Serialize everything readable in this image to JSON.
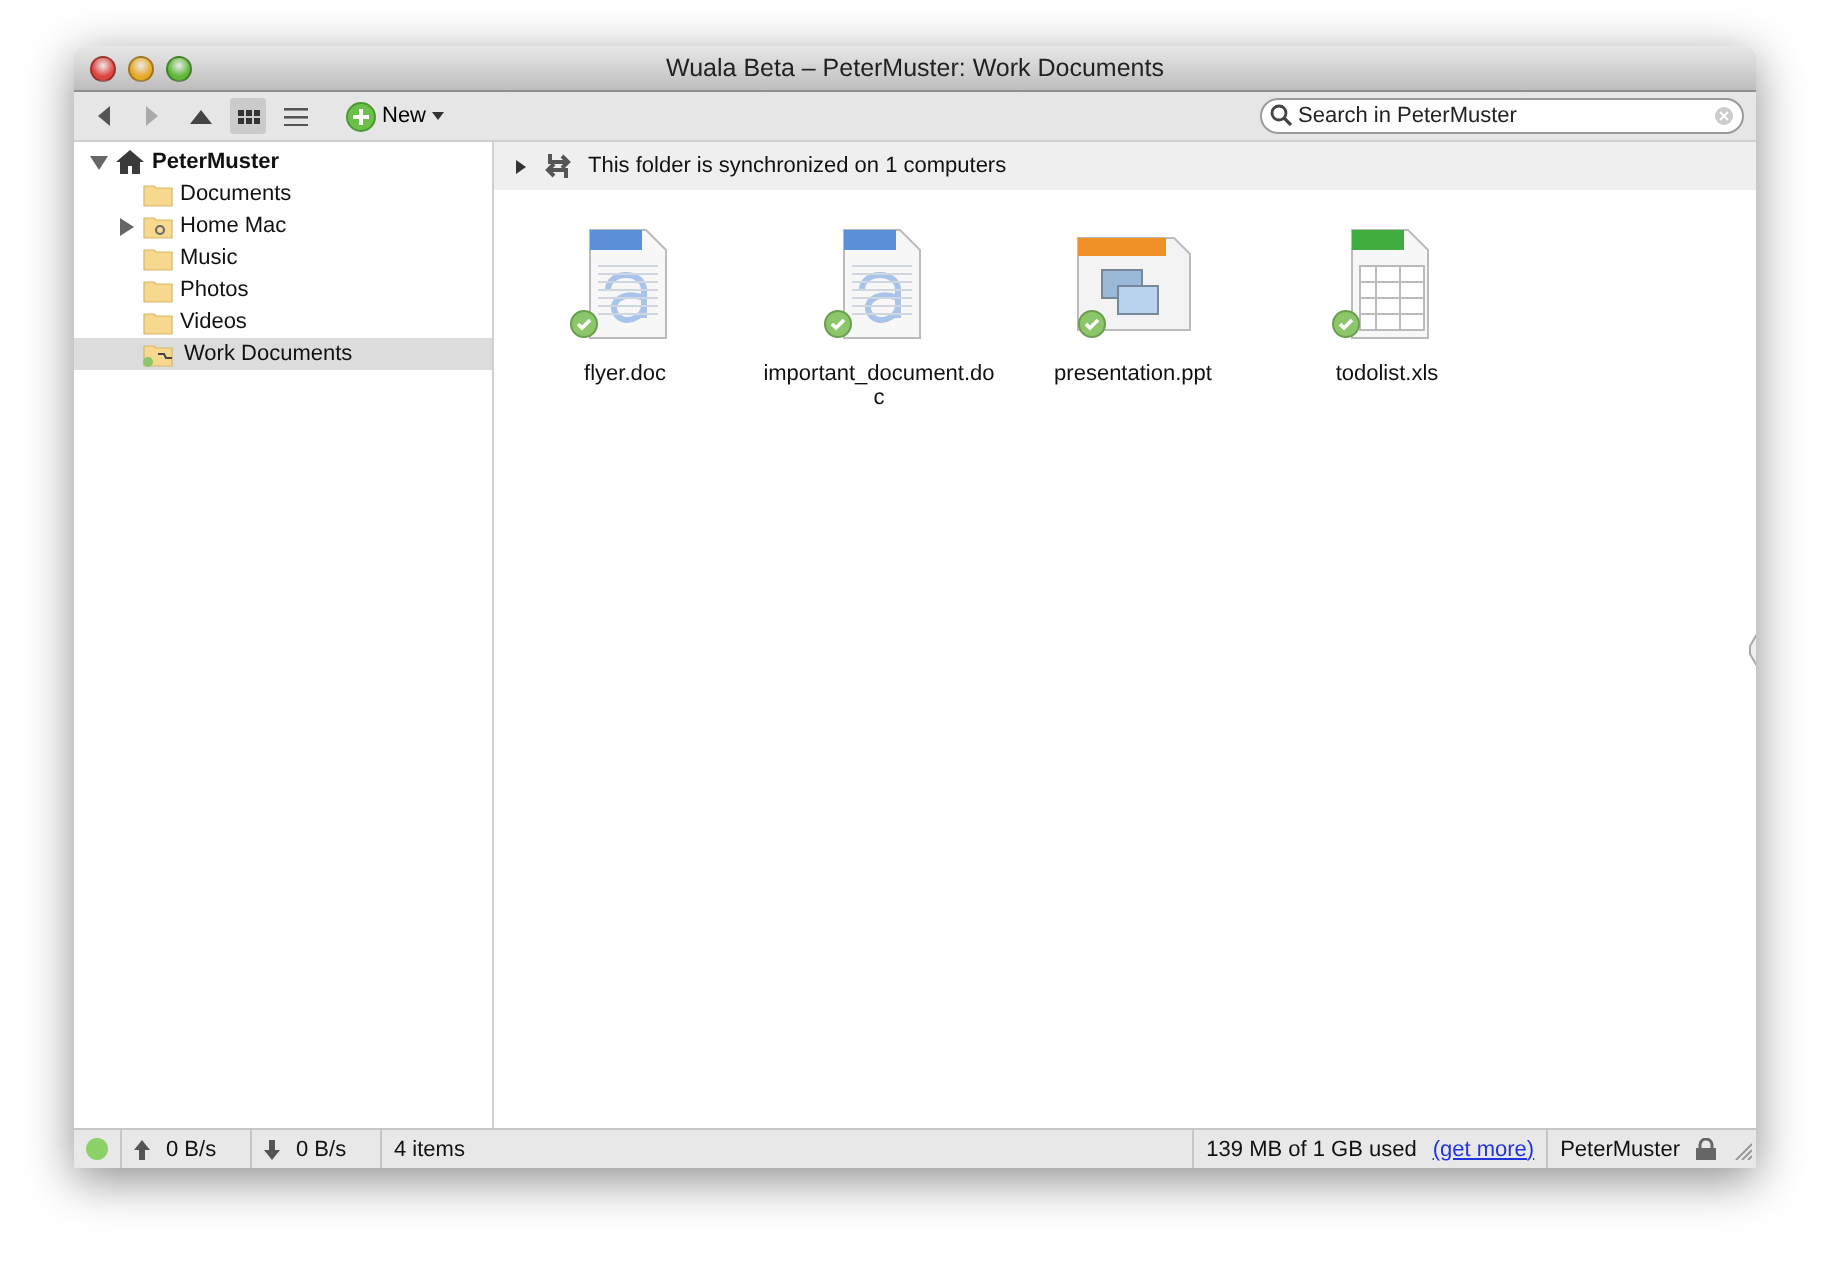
{
  "window": {
    "title": "Wuala Beta – PeterMuster: Work Documents"
  },
  "toolbar": {
    "view_buttons": [
      {
        "kind": "icons",
        "selected": true
      },
      {
        "kind": "list",
        "selected": false
      }
    ],
    "new_button": "New",
    "search": {
      "placeholder": "Search in PeterMuster"
    }
  },
  "sidebar": {
    "tree": [
      {
        "label": "PeterMuster",
        "kind": "home",
        "expanded": true,
        "selected": false,
        "children": [
          {
            "label": "Documents",
            "kind": "folder",
            "selected": false
          },
          {
            "label": "Home Mac",
            "kind": "computer",
            "expanded": false,
            "selected": false
          },
          {
            "label": "Music",
            "kind": "folder",
            "selected": false
          },
          {
            "label": "Photos",
            "kind": "folder",
            "selected": false
          },
          {
            "label": "Videos",
            "kind": "folder",
            "selected": false
          },
          {
            "label": "Work Documents",
            "kind": "shared",
            "selected": true
          }
        ]
      }
    ]
  },
  "info_bar": {
    "expanded": false,
    "text": "This folder is synchronized on 1 computers"
  },
  "files": [
    {
      "name": "flyer.doc",
      "kind": "doc",
      "synced": true
    },
    {
      "name": "important_document.doc",
      "kind": "doc",
      "synced": true
    },
    {
      "name": "presentation.ppt",
      "kind": "ppt",
      "synced": true
    },
    {
      "name": "todolist.xls",
      "kind": "xls",
      "synced": true
    }
  ],
  "status_bar": {
    "online": true,
    "upload": "0 B/s",
    "download": "0 B/s",
    "items": "4 items",
    "storage": "139 MB of 1 GB used",
    "link": "(get more)",
    "user": "PeterMuster"
  }
}
